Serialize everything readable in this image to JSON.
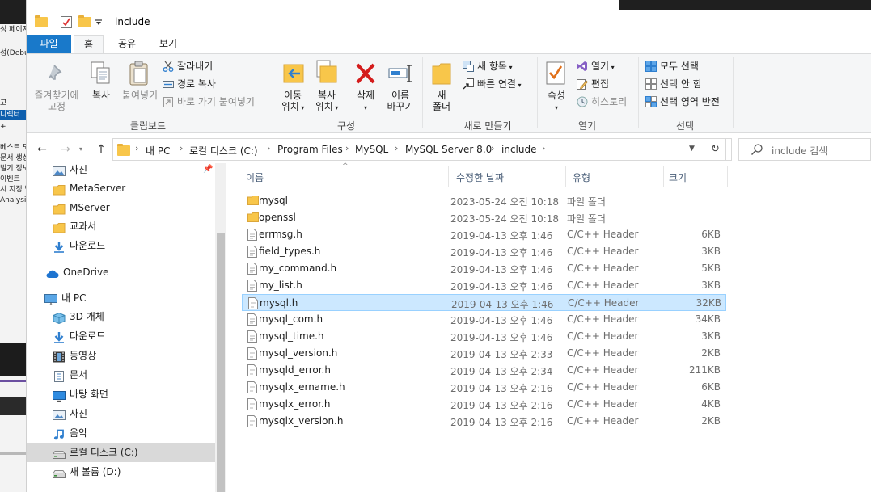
{
  "window": {
    "title": "include"
  },
  "ribbon_tabs": [
    "파일",
    "홈",
    "공유",
    "보기"
  ],
  "ribbon": {
    "clipboard": {
      "group_label": "클립보드",
      "pin": "즐겨찾기에",
      "pin2": "고정",
      "copy": "복사",
      "paste": "붙여넣기",
      "cut": "잘라내기",
      "copy_path": "경로 복사",
      "paste_shortcut": "바로 가기 붙여넣기"
    },
    "organize": {
      "group_label": "구성",
      "move_to": "이동",
      "move_to2": "위치",
      "copy_to": "복사",
      "copy_to2": "위치",
      "delete": "삭제",
      "rename": "이름",
      "rename2": "바꾸기"
    },
    "new": {
      "group_label": "새로 만들기",
      "new_folder": "새",
      "new_folder2": "폴더",
      "new_item": "새 항목",
      "easy_access": "빠른 연결"
    },
    "open": {
      "group_label": "열기",
      "properties": "속성",
      "open": "열기",
      "edit": "편집",
      "history": "히스토리"
    },
    "select": {
      "group_label": "선택",
      "select_all": "모두 선택",
      "select_none": "선택 안 함",
      "invert": "선택 영역 반전"
    }
  },
  "address": {
    "crumbs": [
      "내 PC",
      "로컬 디스크 (C:)",
      "Program Files",
      "MySQL",
      "MySQL Server 8.0",
      "include"
    ],
    "search_placeholder": "include 검색"
  },
  "nav": [
    {
      "label": "사진",
      "icon": "pictures-icon",
      "pinned": true
    },
    {
      "label": "MetaServer",
      "icon": "folder-icon"
    },
    {
      "label": "MServer",
      "icon": "folder-icon"
    },
    {
      "label": "교과서",
      "icon": "folder-icon"
    },
    {
      "label": "다운로드",
      "icon": "download-icon"
    },
    {
      "label": "OneDrive",
      "icon": "onedrive-icon"
    },
    {
      "label": "내 PC",
      "icon": "pc-icon"
    },
    {
      "label": "3D 개체",
      "icon": "3d-objects-icon"
    },
    {
      "label": "다운로드",
      "icon": "download-icon"
    },
    {
      "label": "동영상",
      "icon": "videos-icon"
    },
    {
      "label": "문서",
      "icon": "documents-icon"
    },
    {
      "label": "바탕 화면",
      "icon": "desktop-icon"
    },
    {
      "label": "사진",
      "icon": "pictures-icon"
    },
    {
      "label": "음악",
      "icon": "music-icon"
    },
    {
      "label": "로컬 디스크 (C:)",
      "icon": "drive-icon",
      "selected": true
    },
    {
      "label": "새 볼륨 (D:)",
      "icon": "drive-icon"
    }
  ],
  "columns": {
    "name": "이름",
    "date": "수정한 날짜",
    "type": "유형",
    "size": "크기"
  },
  "files": [
    {
      "name": "mysql",
      "date": "2023-05-24 오전 10:18",
      "type": "파일 폴더",
      "size": "",
      "kind": "folder"
    },
    {
      "name": "openssl",
      "date": "2023-05-24 오전 10:18",
      "type": "파일 폴더",
      "size": "",
      "kind": "folder"
    },
    {
      "name": "errmsg.h",
      "date": "2019-04-13 오후 1:46",
      "type": "C/C++ Header",
      "size": "6KB",
      "kind": "file"
    },
    {
      "name": "field_types.h",
      "date": "2019-04-13 오후 1:46",
      "type": "C/C++ Header",
      "size": "3KB",
      "kind": "file"
    },
    {
      "name": "my_command.h",
      "date": "2019-04-13 오후 1:46",
      "type": "C/C++ Header",
      "size": "5KB",
      "kind": "file"
    },
    {
      "name": "my_list.h",
      "date": "2019-04-13 오후 1:46",
      "type": "C/C++ Header",
      "size": "3KB",
      "kind": "file"
    },
    {
      "name": "mysql.h",
      "date": "2019-04-13 오후 1:46",
      "type": "C/C++ Header",
      "size": "32KB",
      "kind": "file",
      "selected": true
    },
    {
      "name": "mysql_com.h",
      "date": "2019-04-13 오후 1:46",
      "type": "C/C++ Header",
      "size": "34KB",
      "kind": "file"
    },
    {
      "name": "mysql_time.h",
      "date": "2019-04-13 오후 1:46",
      "type": "C/C++ Header",
      "size": "3KB",
      "kind": "file"
    },
    {
      "name": "mysql_version.h",
      "date": "2019-04-13 오후 2:33",
      "type": "C/C++ Header",
      "size": "2KB",
      "kind": "file"
    },
    {
      "name": "mysqld_error.h",
      "date": "2019-04-13 오후 2:34",
      "type": "C/C++ Header",
      "size": "211KB",
      "kind": "file"
    },
    {
      "name": "mysqlx_ername.h",
      "date": "2019-04-13 오후 2:16",
      "type": "C/C++ Header",
      "size": "6KB",
      "kind": "file"
    },
    {
      "name": "mysqlx_error.h",
      "date": "2019-04-13 오후 2:16",
      "type": "C/C++ Header",
      "size": "4KB",
      "kind": "file"
    },
    {
      "name": "mysqlx_version.h",
      "date": "2019-04-13 오후 2:16",
      "type": "C/C++ Header",
      "size": "2KB",
      "kind": "file"
    }
  ],
  "background_app": {
    "lines": [
      "성 페이지",
      "성(Debu",
      "고",
      "디렉터",
      "+",
      "베스트 도",
      "문서 생성",
      "빌기 정보",
      "이벤트",
      "시 지정 빌",
      "Analysis"
    ]
  },
  "colors": {
    "accent": "#1979ca",
    "selection_bg": "#cce8ff",
    "selection_border": "#99d1ff",
    "folder": "#f8c64a"
  }
}
